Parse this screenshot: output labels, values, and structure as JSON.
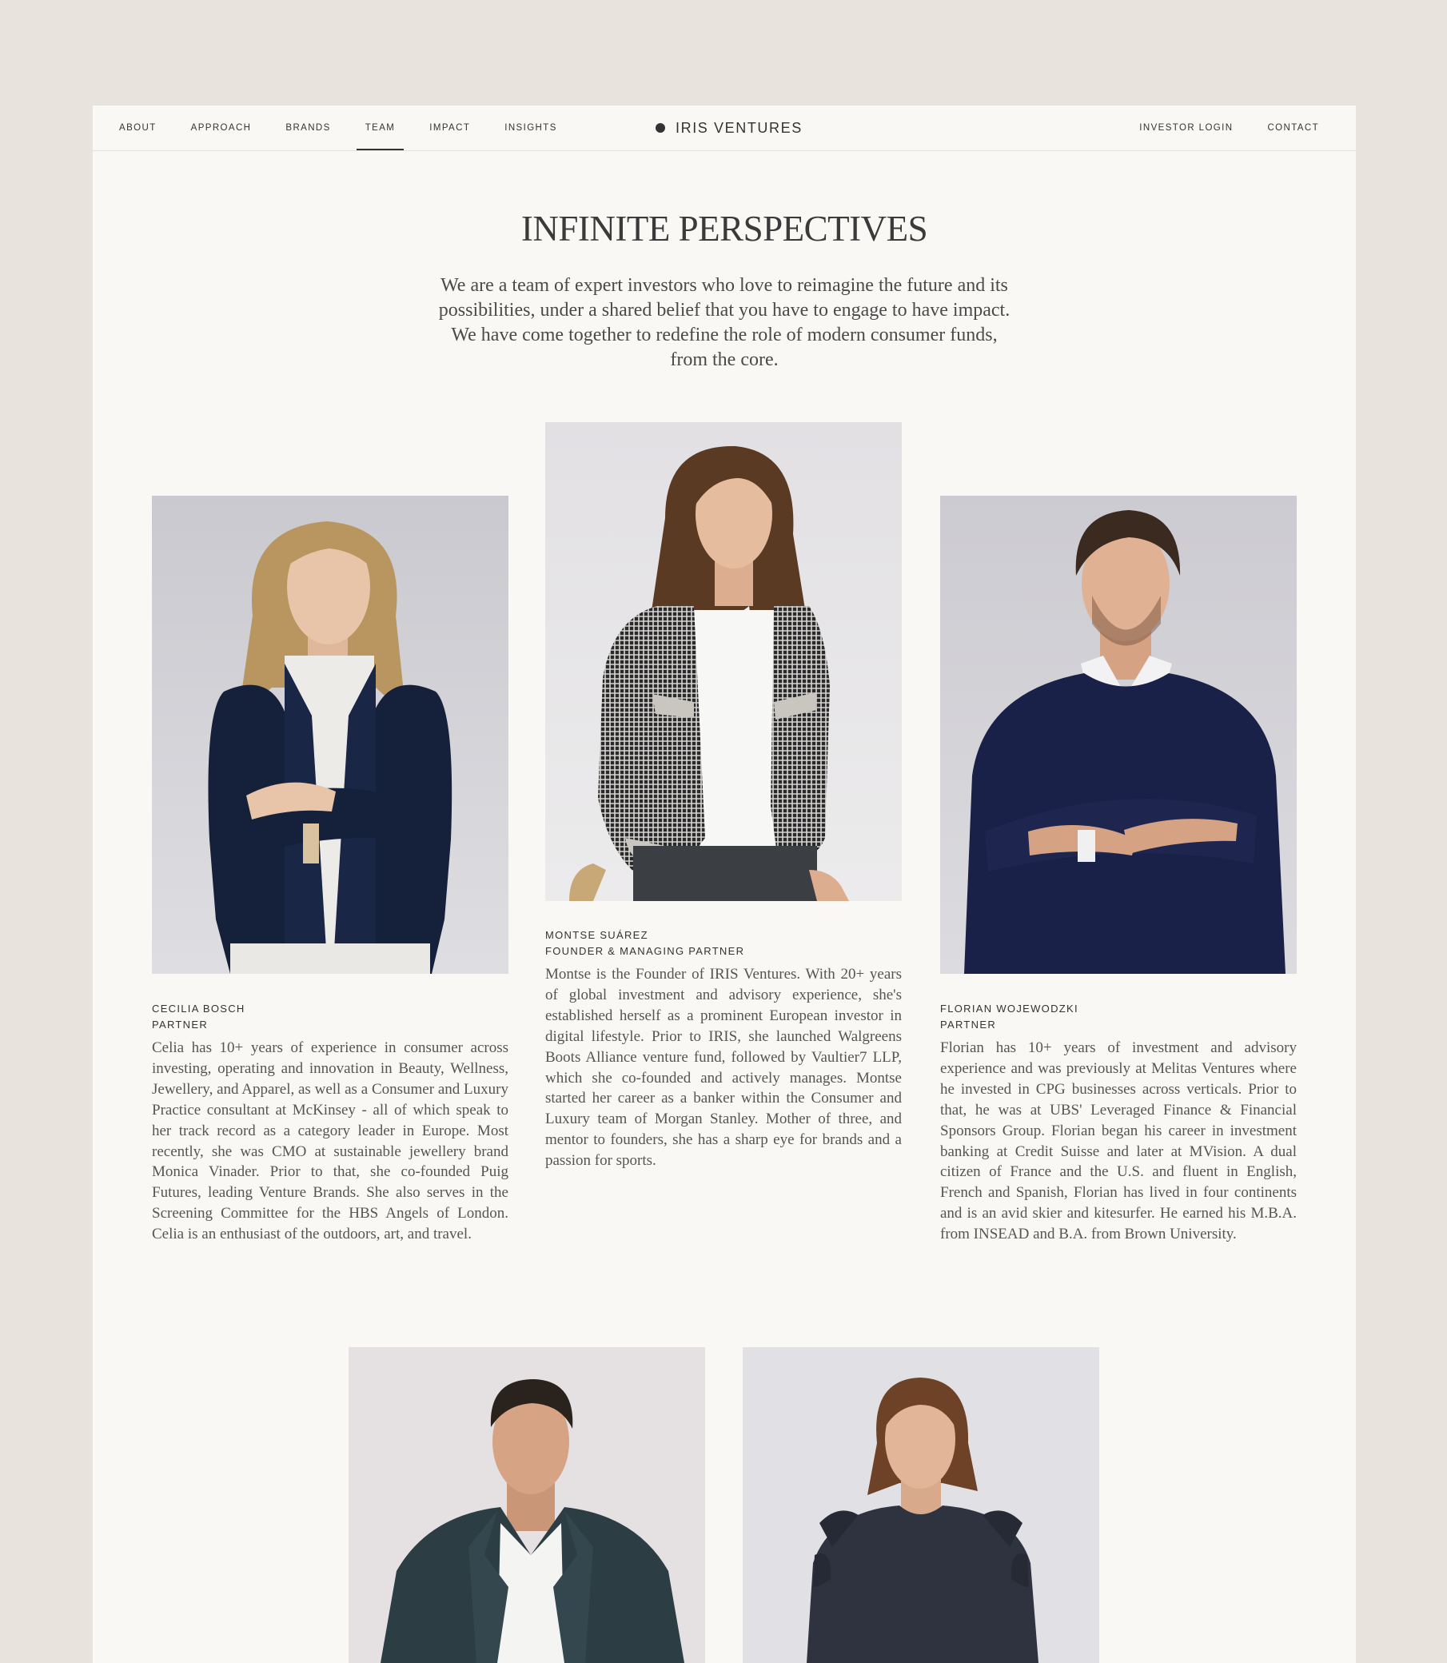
{
  "nav": {
    "left": [
      "ABOUT",
      "APPROACH",
      "BRANDS",
      "TEAM",
      "IMPACT",
      "INSIGHTS"
    ],
    "active": "TEAM",
    "brand": "IRIS VENTURES",
    "right": [
      "INVESTOR LOGIN",
      "CONTACT"
    ]
  },
  "hero": {
    "title": "INFINITE PERSPECTIVES",
    "text": "We are a team of expert investors who love to reimagine the future and its possibilities, under a shared belief that you have to engage to have impact. We have come together to redefine the role of modern consumer funds, from the core."
  },
  "team": [
    {
      "name": "CECILIA BOSCH",
      "role": "PARTNER",
      "bio": "Celia has 10+ years of experience in consumer across investing, operating and innovation in Beauty, Wellness, Jewellery, and Apparel, as well as a Consumer and Luxury Practice consultant at McKinsey - all of which speak to her track record as a category leader in Europe. Most recently, she was CMO at sustainable jewellery brand Monica Vinader. Prior to that, she co-founded Puig Futures, leading Venture Brands. She also serves in the Screening Committee for the HBS Angels of London. Celia is an enthusiast of the outdoors, art, and travel."
    },
    {
      "name": "MONTSE SUÁREZ",
      "role": "FOUNDER & MANAGING PARTNER",
      "bio": "Montse is the Founder of IRIS Ventures. With 20+ years of global investment and advisory experience, she's established herself as a prominent European investor in digital lifestyle. Prior to IRIS, she launched Walgreens Boots Alliance venture fund, followed by Vaultier7 LLP, which she co-founded and actively manages. Montse started her career as a banker within the Consumer and Luxury team of Morgan Stanley. Mother of three, and mentor to founders, she has a sharp eye for brands and a passion for sports."
    },
    {
      "name": "FLORIAN WOJEWODZKI",
      "role": "PARTNER",
      "bio": "Florian has 10+ years of investment and advisory experience and was previously at Melitas Ventures where he invested in CPG businesses across verticals. Prior to that, he was at UBS' Leveraged Finance & Financial Sponsors Group. Florian began his career in investment banking at Credit Suisse and later at MVision. A dual citizen of France and the U.S. and fluent in English, French and Spanish, Florian has lived in four continents and is an avid skier and kitesurfer. He earned his M.B.A. from INSEAD and B.A. from Brown University."
    }
  ]
}
